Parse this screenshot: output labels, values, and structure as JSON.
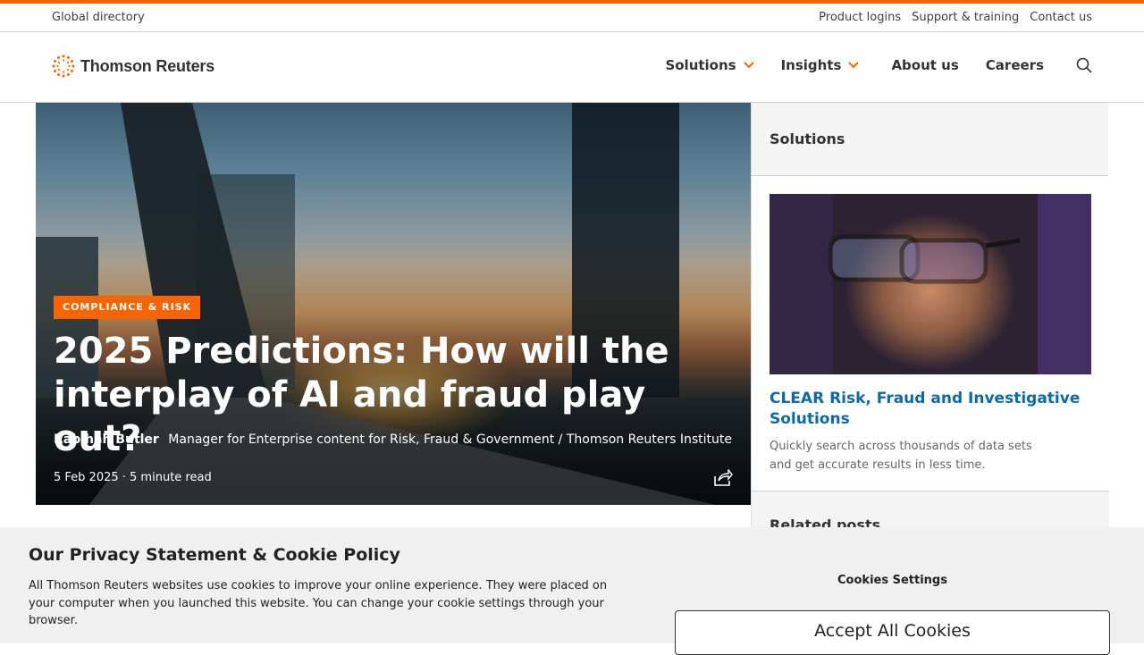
{
  "utility": {
    "global_directory": "Global directory",
    "links": [
      "Product logins",
      "Support & training",
      "Contact us"
    ]
  },
  "brand": {
    "name": "Thomson Reuters",
    "accent": "#fa6400"
  },
  "nav": {
    "items": [
      {
        "label": "Solutions",
        "dropdown": true
      },
      {
        "label": "Insights",
        "dropdown": true
      },
      {
        "label": "About us",
        "dropdown": false
      },
      {
        "label": "Careers",
        "dropdown": false
      }
    ],
    "search_icon": "search-icon"
  },
  "hero": {
    "tag": "COMPLIANCE & RISK",
    "title": "2025 Predictions: How will the interplay of AI and fraud play out?",
    "author": "Rabihah Butler",
    "author_role": "Manager for Enterprise content for Risk, Fraud & Government / Thomson Reuters Institute",
    "meta": "5 Feb 2025 · 5 minute read",
    "share_icon": "share-icon"
  },
  "sidebar": {
    "heading": "Solutions",
    "card": {
      "title": "CLEAR Risk, Fraud and Investigative Solutions",
      "description": "Quickly search across thousands of data sets and get accurate results in less time."
    },
    "related_heading": "Related posts"
  },
  "cookie": {
    "title": "Our Privacy Statement & Cookie Policy",
    "text": "All Thomson Reuters websites use cookies to improve your online experience. They were placed on your computer when you launched this website. You can change your cookie settings through your browser.",
    "settings_label": "Cookies Settings",
    "accept_label": "Accept All Cookies"
  }
}
